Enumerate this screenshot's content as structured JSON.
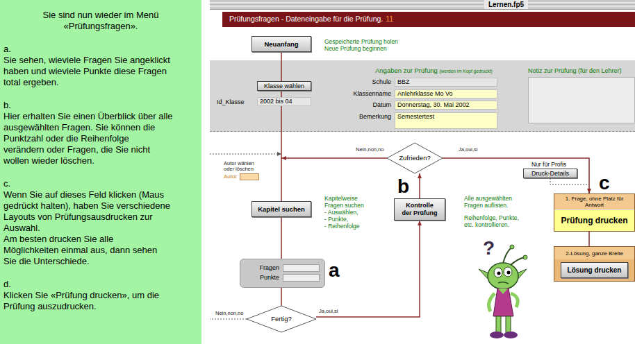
{
  "instructions": {
    "title": [
      "Sie sind nun wieder im Menü",
      "«Prüfungsfragen»."
    ],
    "steps": [
      {
        "letter": "a.",
        "lines": [
          "Sie sehen, wieviele Fragen Sie angeklickt",
          "haben und wieviele Punkte diese Fragen",
          "total ergeben."
        ]
      },
      {
        "letter": "b.",
        "lines": [
          "Hier erhalten Sie einen Überblick über alle",
          "ausgewählten Fragen. Sie können die",
          "Punktzahl oder die Reihenfolge",
          "verändern oder Fragen, die Sie nicht",
          "wollen wieder löschen."
        ]
      },
      {
        "letter": "c.",
        "lines": [
          "Wenn Sie auf dieses Feld klicken (Maus",
          "gedrückt halten), haben Sie verschiedene",
          "Layouts von Prüfungsausdrucken zur",
          "Auswahl.",
          "Am besten drucken Sie alle",
          "Möglichkeiten einmal aus, dann sehen",
          "Sie die Unterschiede."
        ]
      },
      {
        "letter": "d.",
        "lines": [
          "Klicken Sie «Prüfung drucken», um die",
          "Prüfung auszudrucken."
        ]
      }
    ]
  },
  "window": {
    "title": "Lernen.fp5"
  },
  "header": {
    "title": "Prüfungsfragen - Dateneingabe für die Prüfung.",
    "count": "11"
  },
  "start": {
    "button": "Neuanfang",
    "notes": [
      "Gespeicherte Prüfung holen",
      "Neue Prüfung beginnen"
    ]
  },
  "class_select": {
    "button": "Klasse wählen",
    "id_label": "Id_Klasse",
    "id_value": "2002 bis 04"
  },
  "exam_info": {
    "heading": "Angaben zur Prüfung",
    "heading_note": "(werden im Kopf gedruckt)",
    "fields": [
      {
        "label": "Schule",
        "value": "BBZ",
        "kind": "display"
      },
      {
        "label": "Klassenname",
        "value": "Anlehrklasse Mo Vo",
        "kind": "input"
      },
      {
        "label": "Datum",
        "value": "Donnerstag, 30. Mai 2002",
        "kind": "input"
      },
      {
        "label": "Bemerkung",
        "value": "Semestertest",
        "kind": "memo"
      }
    ]
  },
  "teacher_note": {
    "heading": "Notiz zur Prüfung (für den Lehrer)"
  },
  "satisfied": {
    "question": "Zufrieden?",
    "no": "Nein,non,no",
    "yes": "Ja,oui,si"
  },
  "author": {
    "caption": [
      "Autor wählen",
      "oder löschen"
    ],
    "label": "Autor"
  },
  "pro": {
    "caption": "Nur für Profis",
    "button": "Druck-Details"
  },
  "chapter": {
    "button": "Kapitel suchen",
    "notes": [
      "Kapitelweise",
      "Fragen suchen",
      "- Auswählen,",
      "- Punkte,",
      "- Reihenfolge"
    ]
  },
  "check": {
    "marker": "b",
    "button": "Kontrolle der Prüfung",
    "notes": [
      "Alle ausgewählten",
      "Fragen auflisten."
    ],
    "notes2": [
      "Reihenfolge, Punkte,",
      "etc. kontrollieren."
    ]
  },
  "print": {
    "marker": "c",
    "layout1": "1. Frage, ohne Platz für Antwort",
    "print_button": "Prüfung drucken",
    "layout2": "2-Lösung, ganze Breite",
    "solution_button": "Lösung drucken"
  },
  "totals": {
    "marker": "a",
    "rows": [
      {
        "label": "Fragen"
      },
      {
        "label": "Punkte"
      }
    ]
  },
  "done": {
    "question": "Fertig?",
    "no": "Nein,non,no",
    "yes": "Ja,oui,si"
  },
  "mascot": {
    "symbol": "?"
  }
}
